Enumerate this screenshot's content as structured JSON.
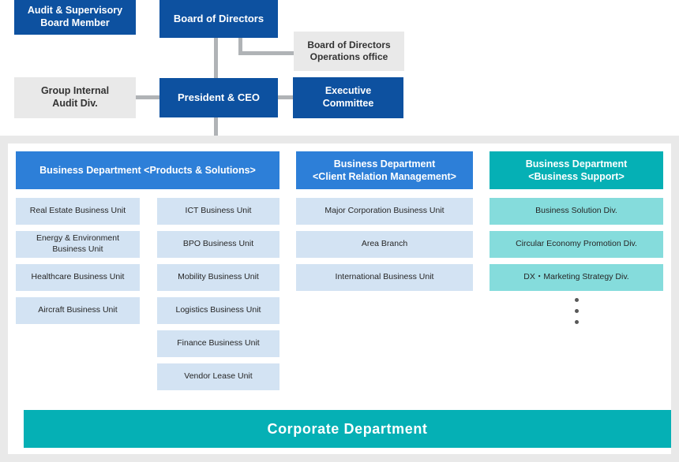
{
  "colors": {
    "exec_box_blue": "#0d51a0",
    "exec_box_gray": "#e9e9e9",
    "dept_blue": "#2d7fd8",
    "dept_teal": "#05b0b5",
    "unit_blue": "#d3e3f3",
    "unit_teal": "#85dcdc",
    "connector_gray": "#b0b3b6",
    "panel_gray": "#e9e9e9",
    "dot_gray": "#585858"
  },
  "executive": {
    "audit_supervisory_board_member": "Audit & Supervisory\nBoard Member",
    "board_of_directors": "Board of Directors",
    "board_of_directors_operations_office": "Board of Directors\nOperations office",
    "group_internal_audit_div": "Group Internal\nAudit Div.",
    "president_ceo": "President & CEO",
    "executive_committee": "Executive\nCommittee"
  },
  "departments": [
    {
      "id": "products-solutions",
      "header": "Business Department <Products & Solutions>",
      "accent": "blue",
      "subcolumns": [
        {
          "units": [
            "Real Estate Business Unit",
            "Energy & Environment\nBusiness Unit",
            "Healthcare Business Unit",
            "Aircraft Business Unit"
          ]
        },
        {
          "units": [
            "ICT Business Unit",
            "BPO Business Unit",
            "Mobility Business Unit",
            "Logistics Business Unit",
            "Finance Business Unit",
            "Vendor Lease Unit"
          ]
        }
      ],
      "dots": 0
    },
    {
      "id": "client-relation-management",
      "header": "Business Department\n<Client Relation Management>",
      "accent": "blue",
      "subcolumns": [
        {
          "units": [
            "Major Corporation Business Unit",
            "Area Branch",
            "International Business Unit"
          ]
        }
      ],
      "dots": 0
    },
    {
      "id": "business-support",
      "header": "Business Department\n<Business Support>",
      "accent": "teal",
      "subcolumns": [
        {
          "units": [
            "Business Solution Div.",
            "Circular Economy Promotion Div.",
            "DX・Marketing Strategy Div."
          ]
        }
      ],
      "dots": 3
    }
  ],
  "corporate_department": "Corporate Department"
}
